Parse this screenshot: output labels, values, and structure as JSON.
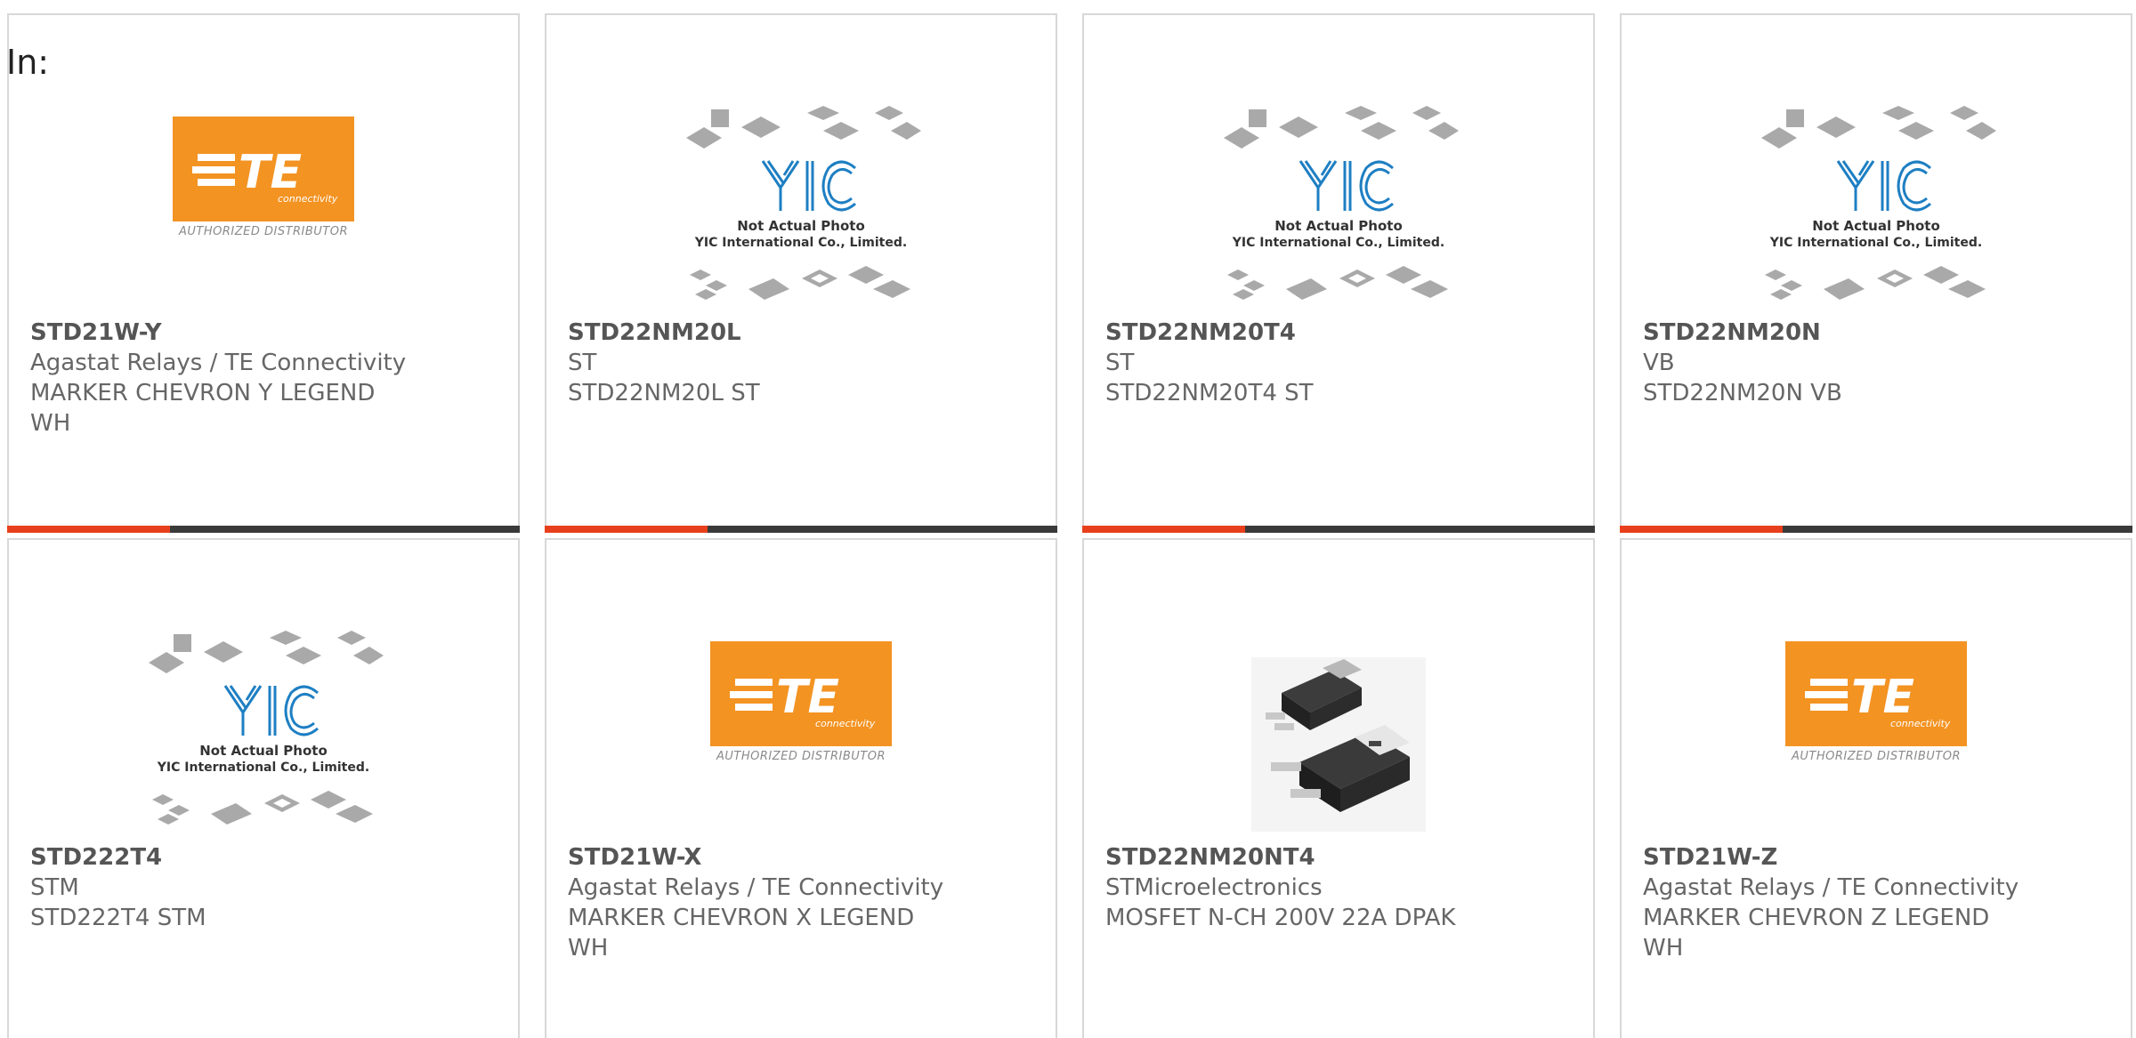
{
  "header": {
    "label": "In:"
  },
  "colors": {
    "accent": "#e8401c",
    "bar": "#3a3a3a",
    "te_orange": "#f39322",
    "yic_blue": "#1e7fc3"
  },
  "images": {
    "te": {
      "icon": "te-connectivity-logo",
      "caption": "AUTHORIZED DISTRIBUTOR"
    },
    "yic": {
      "icon": "yic-placeholder-image",
      "line1": "Not Actual Photo",
      "line2": "YIC International Co., Limited."
    },
    "mosfet": {
      "icon": "dpak-package-image"
    }
  },
  "products": [
    {
      "part": "STD21W-Y",
      "maker": "Agastat Relays / TE Connectivity",
      "desc1": "MARKER CHEVRON Y LEGEND",
      "desc2": "WH",
      "image": "te"
    },
    {
      "part": "STD22NM20L",
      "maker": "ST",
      "desc1": "STD22NM20L ST",
      "desc2": "",
      "image": "yic"
    },
    {
      "part": "STD22NM20T4",
      "maker": "ST",
      "desc1": "STD22NM20T4 ST",
      "desc2": "",
      "image": "yic"
    },
    {
      "part": "STD22NM20N",
      "maker": "VB",
      "desc1": "STD22NM20N VB",
      "desc2": "",
      "image": "yic"
    },
    {
      "part": "STD222T4",
      "maker": "STM",
      "desc1": "STD222T4 STM",
      "desc2": "",
      "image": "yic"
    },
    {
      "part": "STD21W-X",
      "maker": "Agastat Relays / TE Connectivity",
      "desc1": "MARKER CHEVRON X LEGEND",
      "desc2": "WH",
      "image": "te"
    },
    {
      "part": "STD22NM20NT4",
      "maker": "STMicroelectronics",
      "desc1": "MOSFET N-CH 200V 22A DPAK",
      "desc2": "",
      "image": "mosfet"
    },
    {
      "part": "STD21W-Z",
      "maker": "Agastat Relays / TE Connectivity",
      "desc1": "MARKER CHEVRON Z LEGEND",
      "desc2": "WH",
      "image": "te"
    }
  ]
}
